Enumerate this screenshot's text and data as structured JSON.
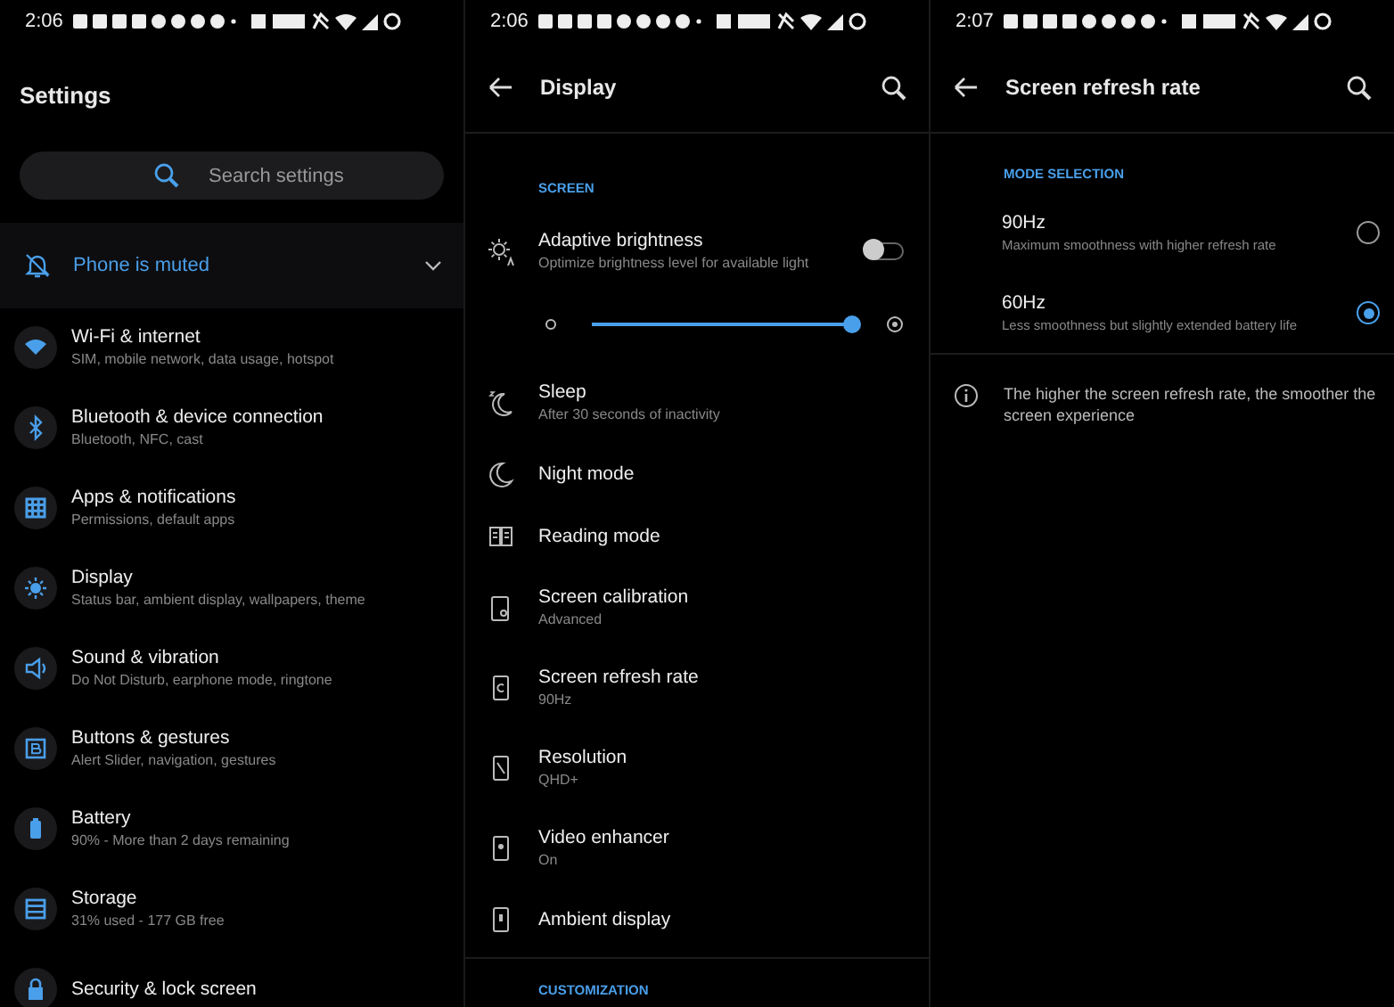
{
  "settings_screen": {
    "status_time": "2:06",
    "title": "Settings",
    "search": {
      "placeholder": "Search settings"
    },
    "muted_banner": {
      "label": "Phone is muted",
      "expanded": false
    },
    "items": [
      {
        "title": "Wi-Fi & internet",
        "subtitle": "SIM, mobile network, data usage, hotspot"
      },
      {
        "title": "Bluetooth & device connection",
        "subtitle": "Bluetooth, NFC, cast"
      },
      {
        "title": "Apps & notifications",
        "subtitle": "Permissions, default apps"
      },
      {
        "title": "Display",
        "subtitle": "Status bar, ambient display, wallpapers, theme"
      },
      {
        "title": "Sound & vibration",
        "subtitle": "Do Not Disturb, earphone mode, ringtone"
      },
      {
        "title": "Buttons & gestures",
        "subtitle": "Alert Slider, navigation, gestures"
      },
      {
        "title": "Battery",
        "subtitle": "90% - More than 2 days remaining"
      },
      {
        "title": "Storage",
        "subtitle": "31% used - 177 GB free"
      },
      {
        "title": "Security & lock screen"
      }
    ]
  },
  "display_screen": {
    "status_time": "2:06",
    "title": "Display",
    "section": "SCREEN",
    "adaptive_brightness": {
      "title": "Adaptive brightness",
      "subtitle": "Optimize brightness level for available light",
      "on": false
    },
    "brightness_slider": {
      "level": 1.0
    },
    "items": [
      {
        "title": "Sleep",
        "subtitle": "After 30 seconds of inactivity"
      },
      {
        "title": "Night mode"
      },
      {
        "title": "Reading mode"
      },
      {
        "title": "Screen calibration",
        "subtitle": "Advanced"
      },
      {
        "title": "Screen refresh rate",
        "subtitle": "90Hz"
      },
      {
        "title": "Resolution",
        "subtitle": "QHD+"
      },
      {
        "title": "Video enhancer",
        "subtitle": "On"
      },
      {
        "title": "Ambient display"
      }
    ],
    "next_section": "CUSTOMIZATION"
  },
  "refresh_rate_screen": {
    "status_time": "2:07",
    "title": "Screen refresh rate",
    "section": "MODE SELECTION",
    "options": [
      {
        "title": "90Hz",
        "subtitle": "Maximum smoothness with higher refresh rate",
        "selected": false
      },
      {
        "title": "60Hz",
        "subtitle": "Less smoothness but slightly extended battery life",
        "selected": true
      }
    ],
    "info": "The higher the screen refresh rate, the smoother the screen experience"
  }
}
